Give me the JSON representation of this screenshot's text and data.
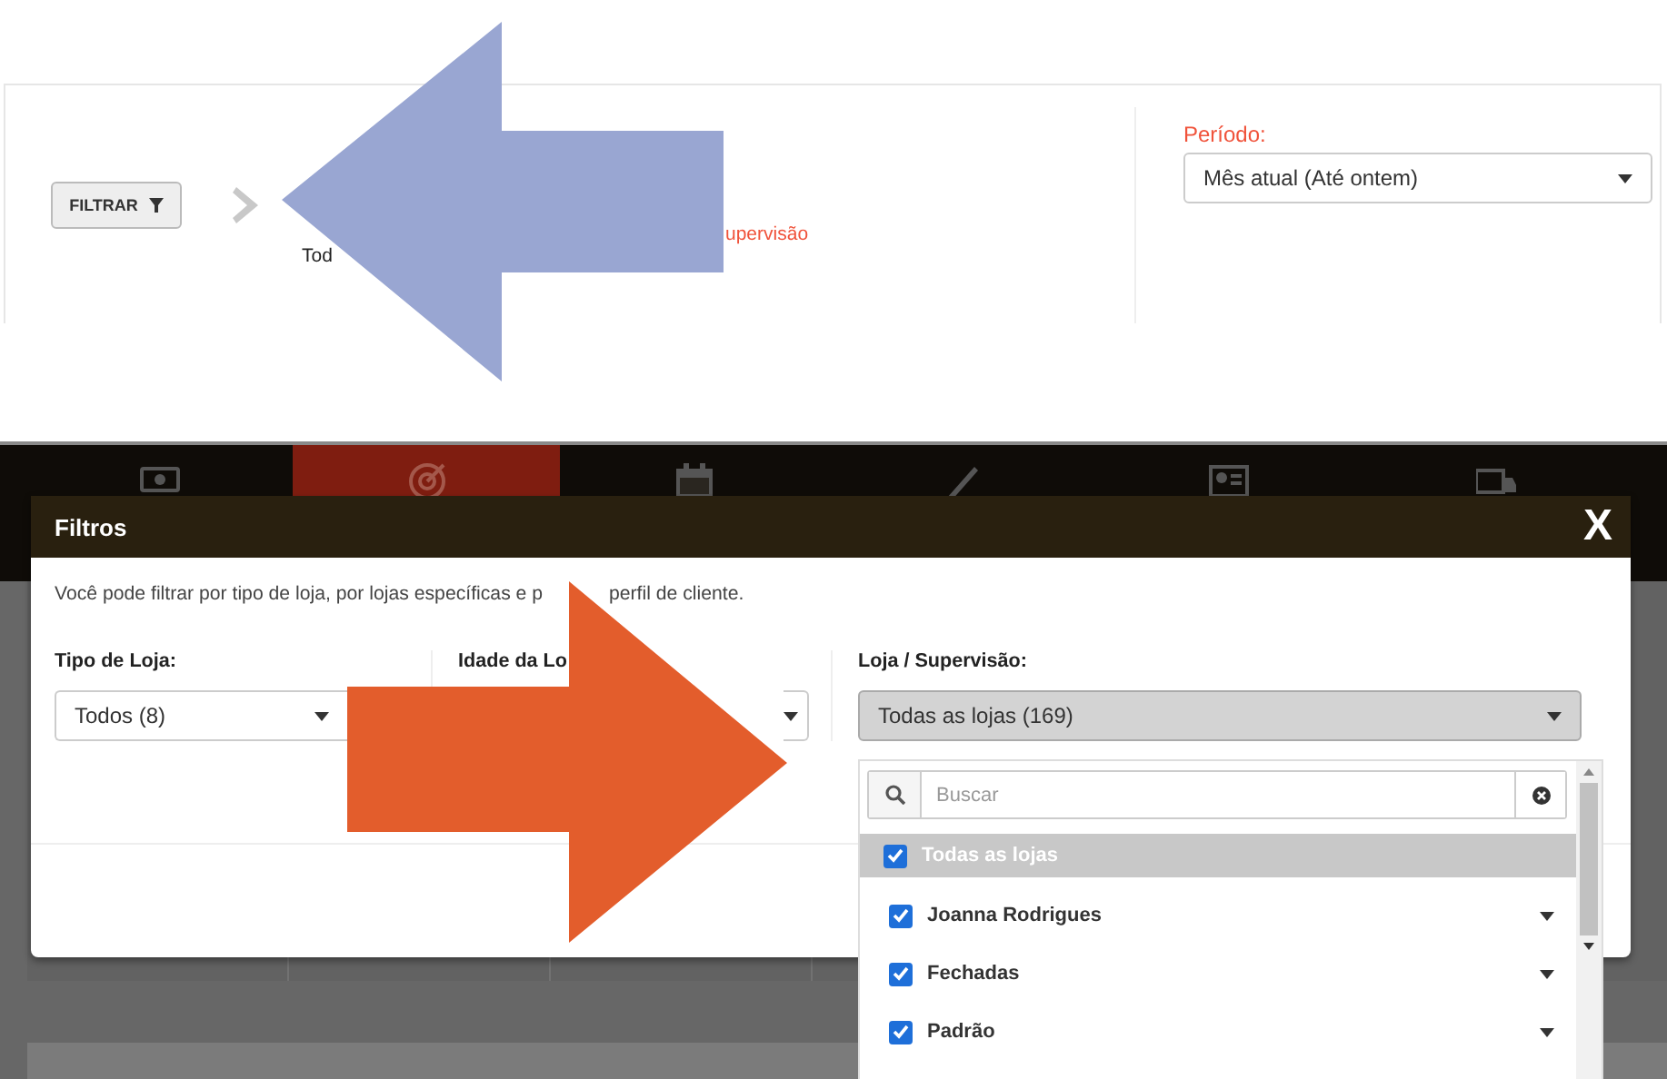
{
  "filter_bar": {
    "filter_button": "FILTRAR",
    "summary_label": "upervisão",
    "summary_value": "Tod",
    "period": {
      "label": "Período:",
      "value": "Mês atual (Até ontem)"
    }
  },
  "nav_tabs": [
    {
      "kind": "money",
      "selected": false
    },
    {
      "kind": "target",
      "selected": true
    },
    {
      "kind": "calendar",
      "selected": false
    },
    {
      "kind": "pencil",
      "selected": false
    },
    {
      "kind": "contact",
      "selected": false
    },
    {
      "kind": "truck",
      "selected": false
    }
  ],
  "dialog": {
    "title": "Filtros",
    "close": "X",
    "description": [
      "Você pode filtrar por tipo de loja, por lojas específicas e p",
      "perfil de cliente."
    ],
    "fields": [
      {
        "label": "Tipo de Loja:",
        "value": "Todos (8)",
        "open": false
      },
      {
        "label": "Idade da Lo",
        "open": false
      },
      {
        "label": "Loja / Supervisão:",
        "value": "Todas as lojas (169)",
        "open": true
      }
    ],
    "dropdown": {
      "search_placeholder": "Buscar",
      "items": [
        {
          "label": "Todas as lojas",
          "checked": true,
          "selected": true,
          "expandable": false
        },
        {
          "label": "Joanna Rodrigues",
          "checked": true,
          "selected": false,
          "expandable": true
        },
        {
          "label": "Fechadas",
          "checked": true,
          "selected": false,
          "expandable": true
        },
        {
          "label": "Padrão",
          "checked": true,
          "selected": false,
          "expandable": true
        }
      ]
    }
  }
}
